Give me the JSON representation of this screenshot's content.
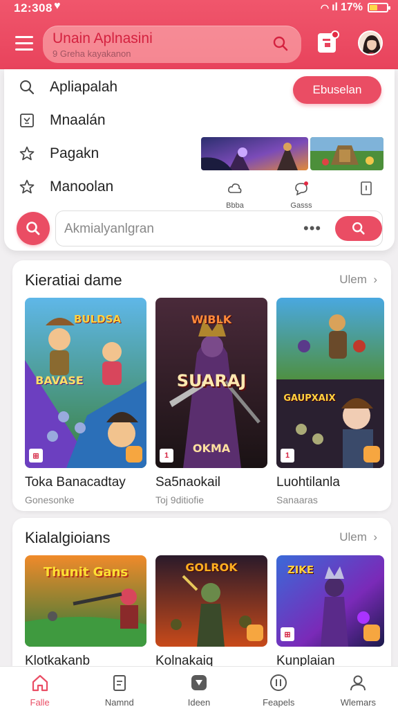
{
  "status_bar": {
    "time": "12:308",
    "battery": "17%"
  },
  "header": {
    "title": "Unain Aplnasini",
    "subtitle": "9 Greha kayakanon"
  },
  "menu": {
    "items": [
      {
        "label": "Apliapalah",
        "icon": "search-icon"
      },
      {
        "label": "Mnaalán",
        "icon": "puzzle-icon"
      },
      {
        "label": "Pagakn",
        "icon": "star-icon"
      },
      {
        "label": "Manoolan",
        "icon": "star-outline-icon"
      }
    ],
    "action_button": "Ebuselan",
    "mini_actions": [
      {
        "label": "Bbba",
        "icon": "cloud-icon"
      },
      {
        "label": "Gasss",
        "icon": "chat-bubble-icon"
      },
      {
        "label": "",
        "icon": "document-icon"
      }
    ]
  },
  "search": {
    "placeholder": "Akmialyanlgran"
  },
  "section_featured": {
    "title": "Kieratiai dame",
    "see_all": "Ulem",
    "games": [
      {
        "name": "Toka Banacadtay",
        "category": "Gonesonke",
        "art_text": "BULDSA",
        "art_text2": "BAVASE"
      },
      {
        "name": "Sa5naokail",
        "category": "Toj 9ditiofie",
        "art_text": "WIBLK",
        "art_text2": "SUARAJ",
        "art_text3": "OKMA"
      },
      {
        "name": "Luohtilanla",
        "category": "Sanaaras",
        "art_text": "GAUPXAIX"
      }
    ]
  },
  "section_second": {
    "title": "Kialalgioians",
    "see_all": "Ulem",
    "games": [
      {
        "name": "Klotkakanb",
        "art_text": "Thunit Gans"
      },
      {
        "name": "Kolnakaiq",
        "art_text": "GOLROK"
      },
      {
        "name": "Kunplaian",
        "art_text": "ZIKE"
      }
    ]
  },
  "bottom_nav": [
    {
      "label": "Falle",
      "icon": "home-icon",
      "active": true
    },
    {
      "label": "Namnd",
      "icon": "clipboard-icon",
      "active": false
    },
    {
      "label": "Ideen",
      "icon": "shield-icon",
      "active": false
    },
    {
      "label": "Feapels",
      "icon": "compass-icon",
      "active": false
    },
    {
      "label": "Wlemars",
      "icon": "user-icon",
      "active": false
    }
  ],
  "colors": {
    "accent": "#ea4d64",
    "header": "#e8435c"
  }
}
